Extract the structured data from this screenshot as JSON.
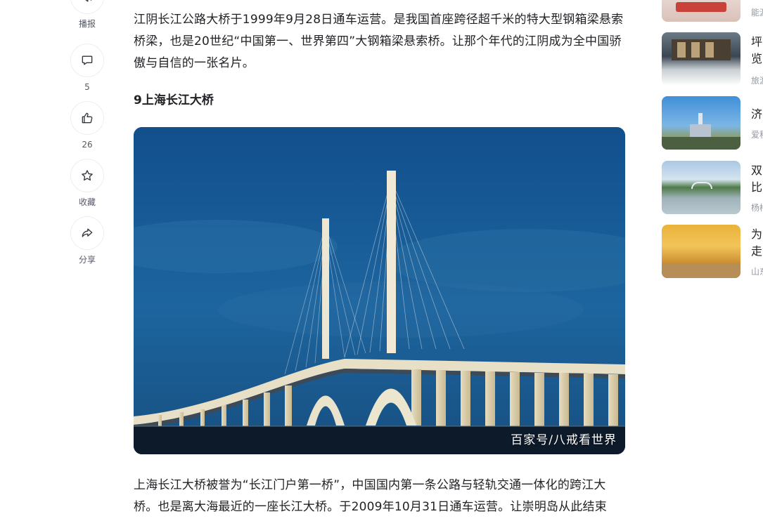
{
  "actions": [
    {
      "name": "read-aloud",
      "label": "播报"
    },
    {
      "name": "comment",
      "label": "5"
    },
    {
      "name": "like",
      "label": "26"
    },
    {
      "name": "favorite",
      "label": "收藏"
    },
    {
      "name": "share",
      "label": "分享"
    }
  ],
  "article": {
    "paragraph1": "江阴长江公路大桥于1999年9月28日通车运营。是我国首座跨径超千米的特大型钢箱梁悬索桥梁，也是20世纪“中国第一、世界第四”大钢箱梁悬索桥。让那个年代的江阴成为全中国骄傲与自信的一张名片。",
    "heading": "9上海长江大桥",
    "image_watermark": "百家号/八戒看世界",
    "paragraph2": "上海长江大桥被誉为“长江门户第一桥”，中国国内第一条公路与轻轨交通一体化的跨江大桥。也是离大海最近的一座长江大桥。于2009年10月31日通车运营。让崇明岛从此结束"
  },
  "recommendations": [
    {
      "title": "",
      "source": "能源"
    },
    {
      "title": "坪览",
      "source": "旅游"
    },
    {
      "title": "济",
      "source": "爱程"
    },
    {
      "title": "双比",
      "source": "杨梅"
    },
    {
      "title": "为走",
      "source": "山东"
    }
  ],
  "colors": {
    "text": "#222226",
    "muted": "#9499a0",
    "sky": "#1b5f99",
    "tower": "#e9e3cf"
  }
}
